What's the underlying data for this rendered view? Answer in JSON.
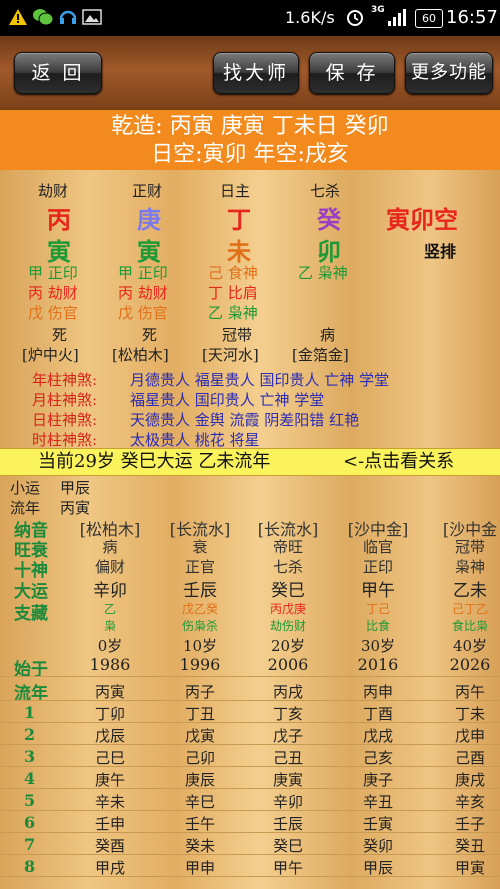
{
  "status": {
    "speed": "1.6K/s",
    "signal": "3G",
    "battery": "60",
    "time": "16:57"
  },
  "nav": {
    "back": "返 回",
    "find_master": "找大师",
    "save": "保 存",
    "more": "更多功能"
  },
  "header": {
    "line1": "乾造: 丙寅 庚寅 丁未日 癸卯",
    "line2": "日空:寅卯 年空:戌亥"
  },
  "pillars": [
    {
      "role": "劫财",
      "stem": "丙",
      "branch": "寅",
      "hidden": [
        "甲 正印",
        "丙 劫财",
        "戊 伤官"
      ],
      "state": "死",
      "nayin": "[炉中火]"
    },
    {
      "role": "正财",
      "stem": "庚",
      "branch": "寅",
      "hidden": [
        "甲 正印",
        "丙 劫财",
        "戊 伤官"
      ],
      "state": "死",
      "nayin": "[松柏木]"
    },
    {
      "role": "日主",
      "stem": "丁",
      "branch": "未",
      "hidden": [
        "己 食神",
        "丁 比肩",
        "乙 枭神"
      ],
      "state": "冠带",
      "nayin": "[天河水]"
    },
    {
      "role": "七杀",
      "stem": "癸",
      "branch": "卯",
      "hidden": [
        "乙 枭神",
        "",
        ""
      ],
      "state": "病",
      "nayin": "[金箔金]"
    }
  ],
  "kong": {
    "text": "寅卯空",
    "vertical": "竖排"
  },
  "shensha": [
    {
      "label": "年柱神煞:",
      "items": "月德贵人 福星贵人 国印贵人 亡神 学堂"
    },
    {
      "label": "月柱神煞:",
      "items": "福星贵人 国印贵人 亡神 学堂"
    },
    {
      "label": "日柱神煞:",
      "items": "天德贵人 金舆 流霞 阴差阳错 红艳"
    },
    {
      "label": "时柱神煞:",
      "items": "太极贵人 桃花 将星"
    }
  ],
  "banner": {
    "text": "当前29岁 癸巳大运 乙未流年",
    "link": "<-点击看关系"
  },
  "xiaoyun": {
    "label": "小运",
    "value": "甲辰"
  },
  "liunian_now": {
    "label": "流年",
    "value": "丙寅"
  },
  "labels": {
    "nayin": "纳音",
    "wangshuai": "旺衰",
    "shishen": "十神",
    "dayun": "大运",
    "zhicang": "支藏",
    "shiyu": "始于",
    "liunian": "流年"
  },
  "dayun": [
    {
      "nayin": "[松柏木]",
      "ws": "病",
      "ss": "偏财",
      "gz": "辛卯",
      "zc1": "乙",
      "zc2": "枭",
      "age": "0岁",
      "year": "1986",
      "ln": [
        "丙寅",
        "丁卯",
        "戊辰",
        "己巳",
        "庚午",
        "辛未",
        "壬申",
        "癸酉",
        "甲戌"
      ]
    },
    {
      "nayin": "[长流水]",
      "ws": "衰",
      "ss": "正官",
      "gz": "壬辰",
      "zc1": "戊乙癸",
      "zc2": "伤枭杀",
      "age": "10岁",
      "year": "1996",
      "ln": [
        "丙子",
        "丁丑",
        "戊寅",
        "己卯",
        "庚辰",
        "辛巳",
        "壬午",
        "癸未",
        "甲申"
      ]
    },
    {
      "nayin": "[长流水]",
      "ws": "帝旺",
      "ss": "七杀",
      "gz": "癸巳",
      "zc1": "丙戊庚",
      "zc2": "劫伤财",
      "age": "20岁",
      "year": "2006",
      "ln": [
        "丙戌",
        "丁亥",
        "戊子",
        "己丑",
        "庚寅",
        "辛卯",
        "壬辰",
        "癸巳",
        "甲午"
      ]
    },
    {
      "nayin": "[沙中金]",
      "ws": "临官",
      "ss": "正印",
      "gz": "甲午",
      "zc1": "丁己",
      "zc2": "比食",
      "age": "30岁",
      "year": "2016",
      "ln": [
        "丙申",
        "丁酉",
        "戊戌",
        "己亥",
        "庚子",
        "辛丑",
        "壬寅",
        "癸卯",
        "甲辰"
      ]
    },
    {
      "nayin": "[沙中金",
      "ws": "冠带",
      "ss": "枭神",
      "gz": "乙未",
      "zc1": "己丁乙",
      "zc2": "食比枭",
      "age": "40岁",
      "year": "2026",
      "ln": [
        "丙午",
        "丁未",
        "戊申",
        "己酉",
        "庚戌",
        "辛亥",
        "壬子",
        "癸丑",
        "甲寅"
      ]
    }
  ],
  "ln_index": [
    "1",
    "2",
    "3",
    "4",
    "5",
    "6",
    "7",
    "8"
  ],
  "colors": {
    "fire": "#e8251b",
    "metal": "#7a7af0",
    "water": "#9a3fc4",
    "wood": "#1d9a36",
    "earth": "#e0701a",
    "label_red": "#d8231b",
    "blue": "#2c2cb4"
  }
}
